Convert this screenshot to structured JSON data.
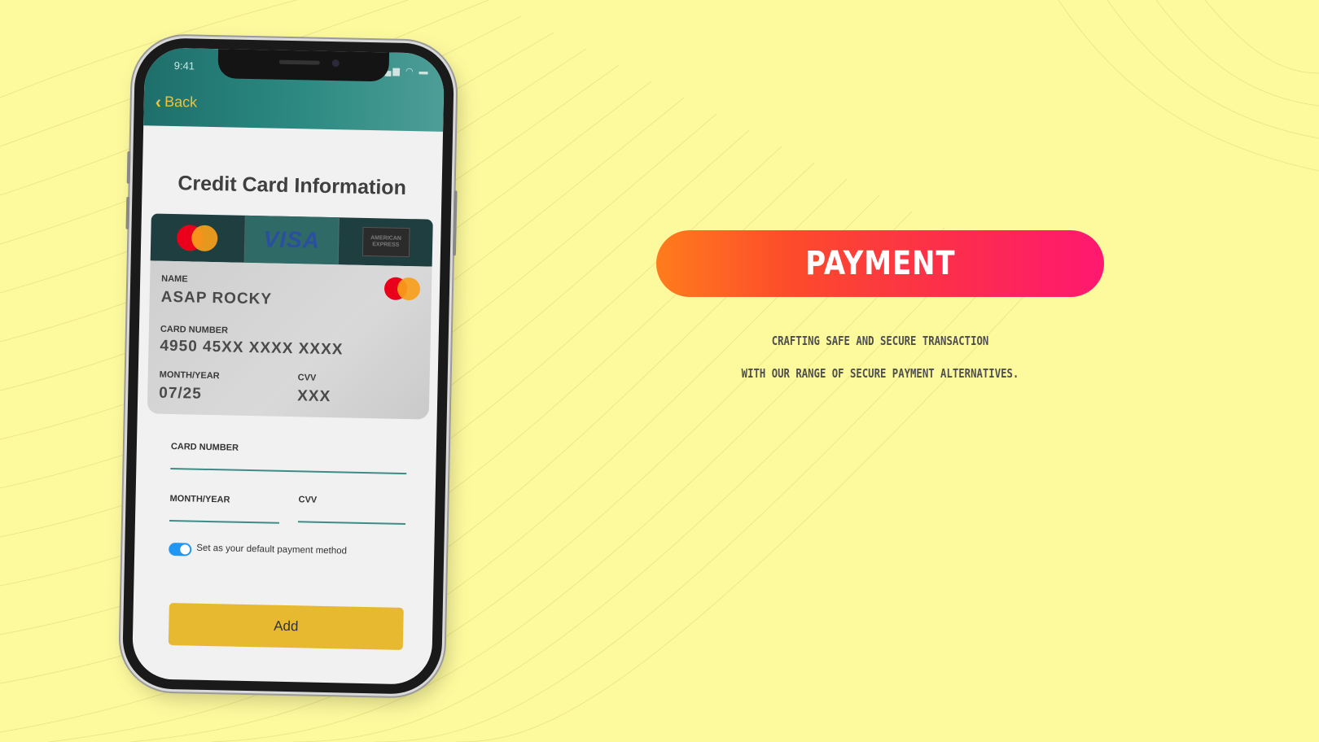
{
  "colors": {
    "background": "#fdfa9e",
    "accent_teal": "#2d8b83",
    "button_yellow": "#e7b931",
    "pill_gradient_start": "#ff7c1c",
    "pill_gradient_end": "#ff1870"
  },
  "phone": {
    "status_bar": {
      "time": "9:41",
      "icons": "signal-icon wifi-icon battery-icon"
    },
    "header": {
      "back_label": "Back",
      "back_icon": "chevron-left-icon"
    },
    "title": "Credit Card Information",
    "brands": [
      {
        "name": "mastercard",
        "icon": "mastercard-icon"
      },
      {
        "name": "VISA",
        "icon": "visa-icon"
      },
      {
        "name": "AMERICAN EXPRESS",
        "icon": "amex-icon"
      }
    ],
    "card_preview": {
      "name_label": "NAME",
      "name_value": "ASAP ROCKY",
      "number_label": "CARD NUMBER",
      "number_value": "4950 45XX XXXX XXXX",
      "expiry_label": "MONTH/YEAR",
      "expiry_value": "07/25",
      "cvv_label": "CVV",
      "cvv_value": "XXX"
    },
    "form": {
      "card_number_label": "CARD NUMBER",
      "expiry_label": "MONTH/YEAR",
      "cvv_label": "CVV",
      "default_toggle_label": "Set as your default payment method",
      "default_toggle_on": true,
      "add_button_label": "Add"
    }
  },
  "promo": {
    "title": "PAYMENT",
    "tagline_line1": "CRAFTING SAFE AND SECURE TRANSACTION",
    "tagline_line2": "WITH OUR RANGE OF SECURE PAYMENT ALTERNATIVES."
  }
}
